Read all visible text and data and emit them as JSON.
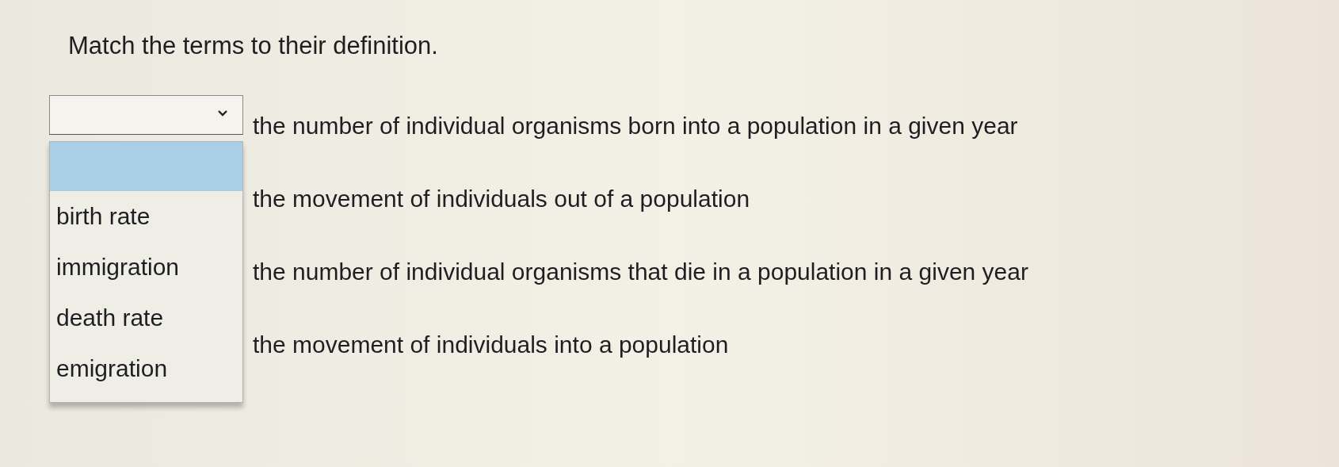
{
  "title": "Match the terms to their definition.",
  "rows": [
    {
      "definition": "the number of individual organisms born into a population in a given year"
    },
    {
      "definition": "the movement of individuals out of a population"
    },
    {
      "definition": "the number of individual organisms that die in a population in a given year"
    },
    {
      "definition": "the movement of individuals into a population"
    }
  ],
  "dropdown": {
    "open": true,
    "blank_highlighted": true,
    "options": [
      {
        "label": "birth rate",
        "highlighted": false
      },
      {
        "label": "immigration",
        "highlighted": false
      },
      {
        "label": "death rate",
        "highlighted": false
      },
      {
        "label": "emigration",
        "highlighted": false
      }
    ]
  }
}
